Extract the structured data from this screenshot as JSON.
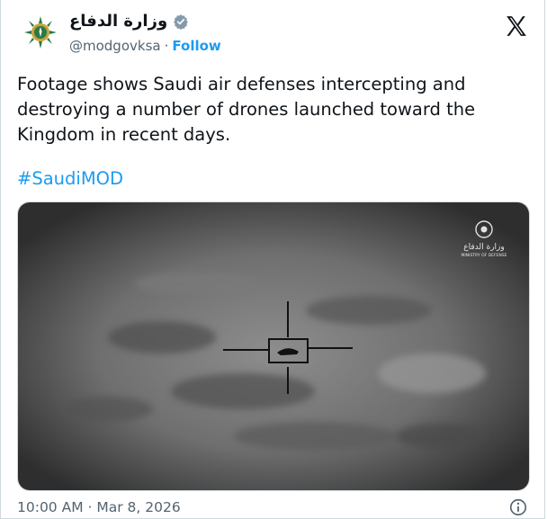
{
  "tweet": {
    "author": {
      "display_name": "وزارة الدفاع",
      "handle": "@modgovksa",
      "follow_label": "Follow",
      "avatar_icon": "ministry-emblem-icon",
      "verified_icon": "verified-badge-icon"
    },
    "platform_icon": "x-logo-icon",
    "text": "Footage shows Saudi air defenses intercepting and destroying a number of drones launched toward the Kingdom in recent days.",
    "hashtag": "#SaudiMOD",
    "media": {
      "watermark_ar": "وزارة الدفاع",
      "watermark_en": "MINISTRY OF DEFENSE"
    },
    "timestamp": "10:00 AM · Mar 8, 2026",
    "info_icon": "info-icon"
  },
  "colors": {
    "accent": "#1d9bf0",
    "text": "#0f1419",
    "muted": "#536471",
    "border": "#cfd9de",
    "emblem_green": "#1f6b3a"
  }
}
